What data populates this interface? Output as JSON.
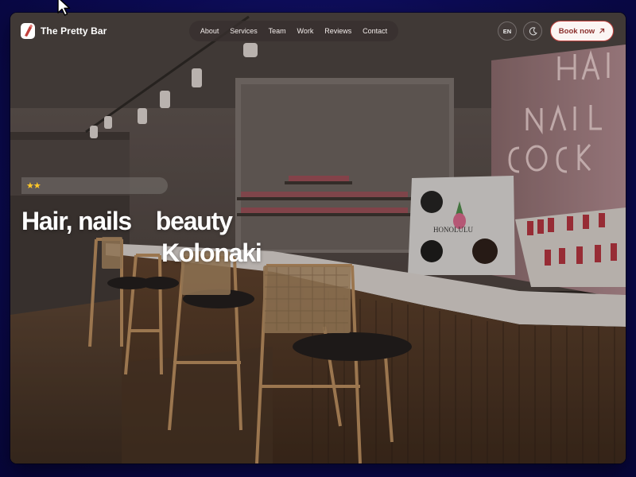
{
  "brand": {
    "name": "The Pretty Bar",
    "logo_icon": "lipstick-icon"
  },
  "nav": {
    "links": [
      "About",
      "Services",
      "Team",
      "Work",
      "Reviews",
      "Contact"
    ]
  },
  "header_actions": {
    "language": "EN",
    "theme_icon": "moon-icon",
    "book_label": "Book now",
    "book_icon": "arrow-up-right-icon"
  },
  "hero": {
    "stars": "★★",
    "line1": "Hair, nails    beauty",
    "line2": "Kolonaki",
    "background_image": "beauty salon interior with wooden bar counter, stools, nail polish shelves and neon sign"
  },
  "colors": {
    "accent": "#c2403c",
    "backdrop": "#0c0b55",
    "star": "#ffc928"
  }
}
